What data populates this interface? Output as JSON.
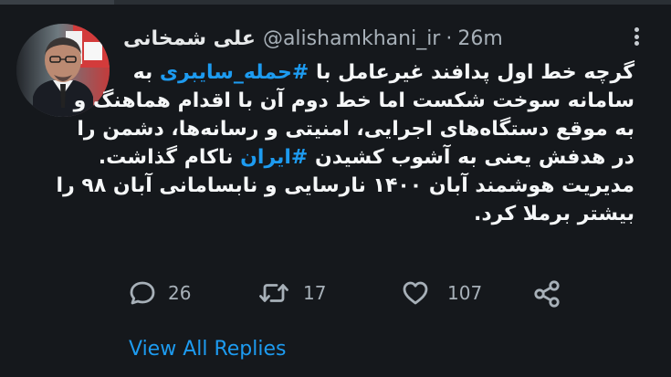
{
  "header": {
    "display_name": "علی شمخانی",
    "handle": "@alishamkhani_ir",
    "separator": "·",
    "time": "26m"
  },
  "tweet": {
    "line1_before": "گرچه خط اول پدافند غیرعامل با ",
    "hashtag1": "#حمله_سایبری",
    "line1_after": " به",
    "line2": "سامانه سوخت شکست اما خط دوم آن با اقدام هماهنگ و",
    "line3": "به موقع دستگاه‌های اجرایی، امنیتی و رسانه‌ها، دشمن را",
    "line4_before": "در هدفش یعنی به آشوب کشیدن ",
    "hashtag2": "#ایران",
    "line4_after": " ناکام گذاشت.",
    "line5": "مدیریت هوشمند آبان ۱۴۰۰ نارسایی و نابسامانی آبان ۹۸ را",
    "line6": "بیشتر برملا کرد."
  },
  "actions": {
    "reply_count": "26",
    "retweet_count": "17",
    "like_count": "107"
  },
  "thread": {
    "view_all_label": "View All Replies"
  },
  "icons": {
    "reply": "comment-icon",
    "retweet": "retweet-icon",
    "like": "heart-icon",
    "share": "share-icon",
    "more": "more-options-icon"
  },
  "colors": {
    "background": "#15181c",
    "text": "#e7e9ea",
    "secondary": "#a7b0b8",
    "accent": "#1d9bf0"
  }
}
